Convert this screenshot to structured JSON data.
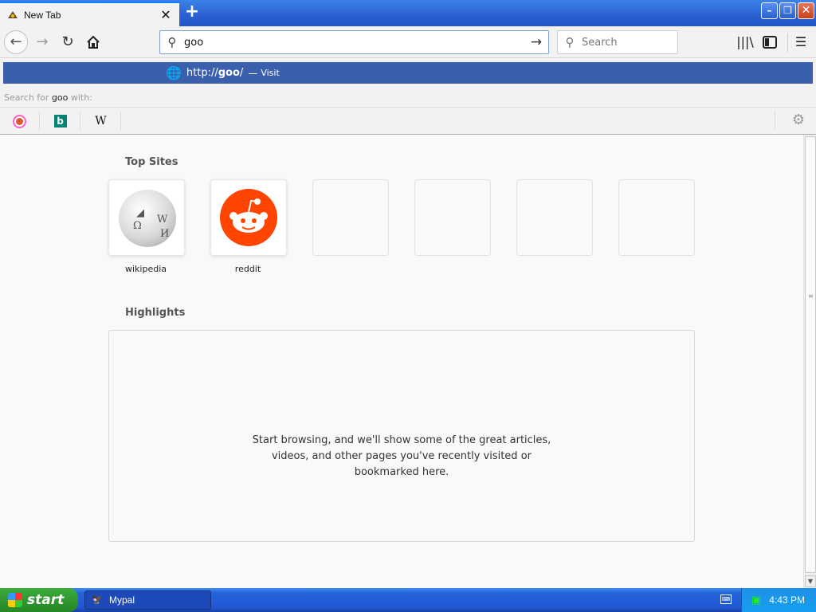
{
  "tab": {
    "title": "New Tab",
    "close_label": "✕"
  },
  "toolbar": {
    "url_value": "goo",
    "search_placeholder": "Search"
  },
  "popup": {
    "suggestion_url_prefix": "http://",
    "suggestion_url_bold": "goo",
    "suggestion_url_suffix": "/",
    "suggestion_dash": "—",
    "suggestion_action": "Visit",
    "search_with_prefix": "Search for ",
    "search_with_term": "goo",
    "search_with_suffix": " with:",
    "engines": [
      "duckduckgo-icon",
      "bing-icon",
      "wikipedia-icon"
    ],
    "wiki_glyph": "W"
  },
  "content": {
    "top_sites_title": "Top Sites",
    "top_sites": [
      {
        "label": "wikipedia"
      },
      {
        "label": "reddit"
      }
    ],
    "highlights_title": "Highlights",
    "highlights_empty": [
      "Start browsing, and we'll show some of the great articles,",
      "videos, and other pages you've recently visited or",
      "bookmarked here."
    ]
  },
  "taskbar": {
    "start_label": "start",
    "task_label": "Mypal",
    "clock": "4:43 PM"
  },
  "colors": {
    "suggestion_bg": "#3a5fac",
    "reddit": "#ff4500",
    "taskbar": "#2257d6",
    "start": "#2e932e"
  }
}
